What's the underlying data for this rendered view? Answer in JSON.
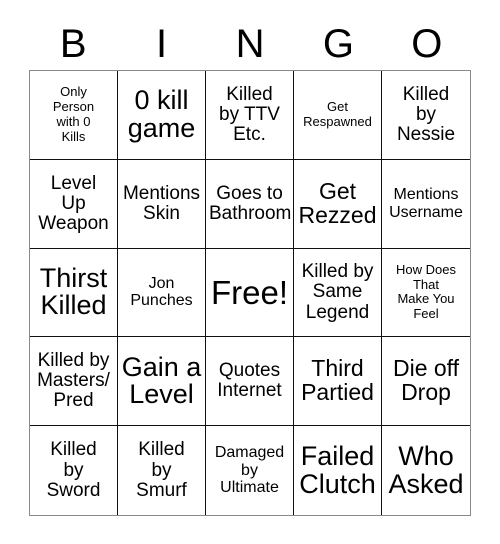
{
  "card": {
    "title": "BINGO",
    "headers": [
      "B",
      "I",
      "N",
      "G",
      "O"
    ],
    "free_space": "Free!",
    "line_color": "#111111",
    "border_color": "#8a8a8a",
    "background_color": "#ffffff",
    "text_color": "#000000",
    "rows": [
      [
        {
          "text": "Only\nPerson\nwith 0\nKills",
          "size": "xs"
        },
        {
          "text": "0 kill\ngame",
          "size": "xl"
        },
        {
          "text": "Killed\nby TTV\nEtc.",
          "size": "m"
        },
        {
          "text": "Get\nRespawned",
          "size": "xs"
        },
        {
          "text": "Killed\nby\nNessie",
          "size": "m"
        }
      ],
      [
        {
          "text": "Level\nUp\nWeapon",
          "size": "m"
        },
        {
          "text": "Mentions\nSkin",
          "size": "m"
        },
        {
          "text": "Goes to\nBathroom",
          "size": "m"
        },
        {
          "text": "Get\nRezzed",
          "size": "l"
        },
        {
          "text": "Mentions\nUsername",
          "size": "s"
        }
      ],
      [
        {
          "text": "Thirst\nKilled",
          "size": "xl"
        },
        {
          "text": "Jon\nPunches",
          "size": "s"
        },
        {
          "text": "Free!",
          "size": "xxl"
        },
        {
          "text": "Killed by\nSame\nLegend",
          "size": "m"
        },
        {
          "text": "How Does\nThat\nMake You\nFeel",
          "size": "xs"
        }
      ],
      [
        {
          "text": "Killed by\nMasters/\nPred",
          "size": "m"
        },
        {
          "text": "Gain a\nLevel",
          "size": "xl"
        },
        {
          "text": "Quotes\nInternet",
          "size": "m"
        },
        {
          "text": "Third\nPartied",
          "size": "l"
        },
        {
          "text": "Die off\nDrop",
          "size": "l"
        }
      ],
      [
        {
          "text": "Killed\nby\nSword",
          "size": "m"
        },
        {
          "text": "Killed\nby\nSmurf",
          "size": "m"
        },
        {
          "text": "Damaged\nby\nUltimate",
          "size": "s"
        },
        {
          "text": "Failed\nClutch",
          "size": "xl"
        },
        {
          "text": "Who\nAsked",
          "size": "xl"
        }
      ]
    ]
  }
}
